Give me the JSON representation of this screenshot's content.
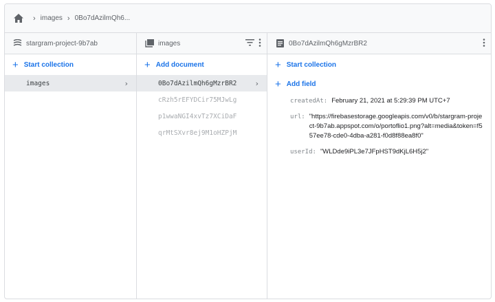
{
  "breadcrumb": {
    "items": [
      "images",
      "0Bo7dAzilmQh6..."
    ]
  },
  "columns": {
    "project": {
      "title": "stargram-project-9b7ab",
      "action_label": "Start collection",
      "items": [
        {
          "label": "images",
          "selected": true
        }
      ]
    },
    "collection": {
      "title": "images",
      "action_label": "Add document",
      "items": [
        {
          "label": "0Bo7dAzilmQh6gMzrBR2",
          "selected": true
        },
        {
          "label": "cRzh5rEFYDCir75MJwLg",
          "selected": false
        },
        {
          "label": "p1wwaNGI4xvTz7XCiDaF",
          "selected": false
        },
        {
          "label": "qrMtSXvr8ej9M1oHZPjM",
          "selected": false
        }
      ]
    },
    "document": {
      "title": "0Bo7dAzilmQh6gMzrBR2",
      "start_collection_label": "Start collection",
      "add_field_label": "Add field",
      "fields": [
        {
          "name": "createdAt:",
          "value": "February 21, 2021 at 5:29:39 PM UTC+7"
        },
        {
          "name": "url:",
          "value": "\"https://firebasestorage.googleapis.com/v0/b/stargram-project-9b7ab.appspot.com/o/portoflio1.png?alt=media&token=f557ee78-cde0-4dba-a281-f0d8f88ea8f0\""
        },
        {
          "name": "userId:",
          "value": "\"WLDde9iPL3e7JFpHST9dKjL6H5j2\""
        }
      ]
    }
  }
}
